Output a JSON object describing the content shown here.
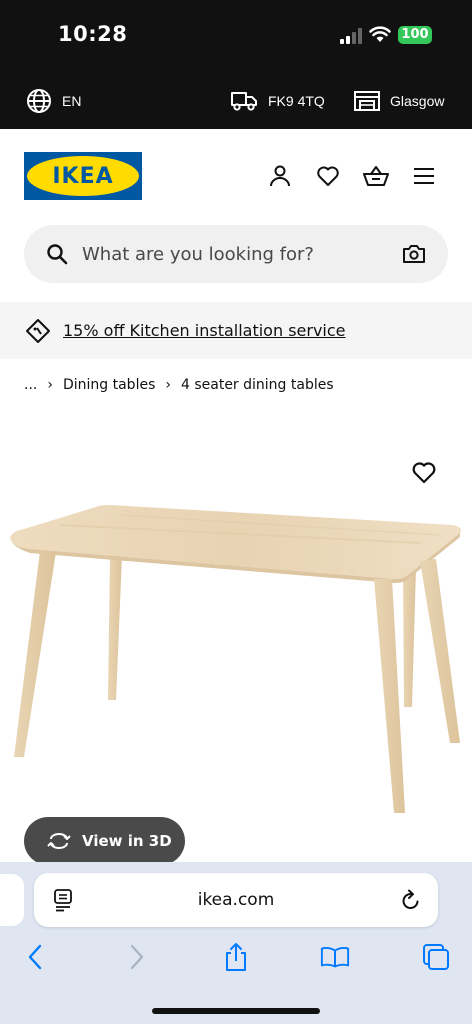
{
  "status_bar": {
    "time": "10:28",
    "battery": "100"
  },
  "utility_bar": {
    "language": "EN",
    "postcode": "FK9 4TQ",
    "store": "Glasgow"
  },
  "header": {
    "logo_text": "IKEA"
  },
  "search": {
    "placeholder": "What are you looking for?"
  },
  "promo": {
    "text": "15% off Kitchen installation service"
  },
  "breadcrumb": {
    "items": [
      "...",
      "Dining tables",
      "4 seater dining tables"
    ]
  },
  "product": {
    "view_3d_label": "View in 3D"
  },
  "browser": {
    "url": "ikea.com"
  },
  "colors": {
    "ikea_blue": "#0058a3",
    "ikea_yellow": "#ffdb00",
    "dark": "#111111",
    "battery_green": "#34c759",
    "safari_bg": "#dfe6f1",
    "link_blue": "#007aff"
  }
}
